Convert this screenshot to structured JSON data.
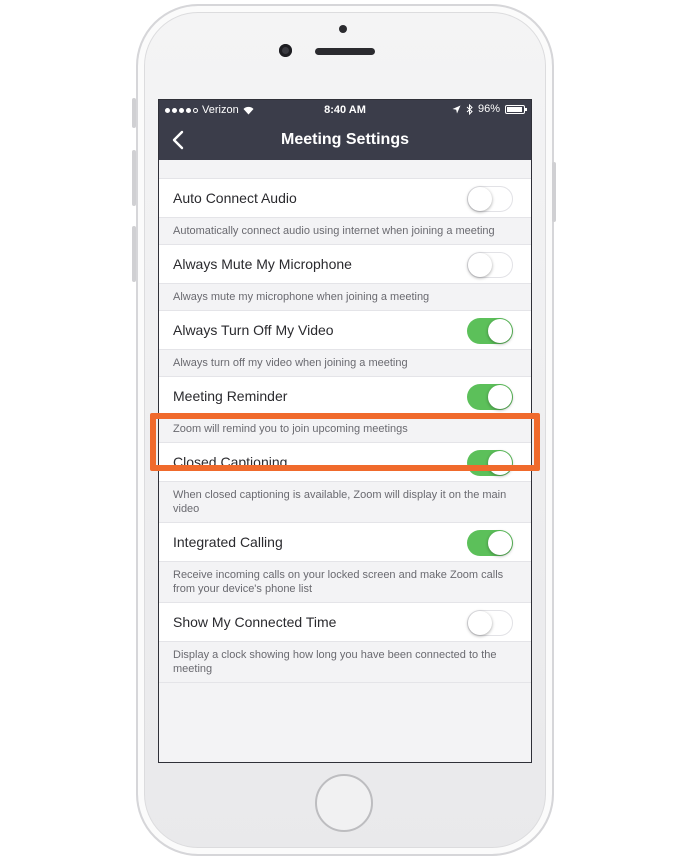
{
  "statusbar": {
    "carrier": "Verizon",
    "time": "8:40 AM",
    "battery": "96%"
  },
  "navbar": {
    "title": "Meeting Settings"
  },
  "settings": [
    {
      "label": "Auto Connect Audio",
      "enabled": false,
      "description": "Automatically connect audio using internet when joining a meeting"
    },
    {
      "label": "Always Mute My Microphone",
      "enabled": false,
      "description": "Always mute my microphone when joining a meeting"
    },
    {
      "label": "Always Turn Off My Video",
      "enabled": true,
      "description": "Always turn off my video when joining a meeting"
    },
    {
      "label": "Meeting Reminder",
      "enabled": true,
      "description": "Zoom will remind you to join upcoming meetings"
    },
    {
      "label": "Closed Captioning",
      "enabled": true,
      "description": "When closed captioning is available, Zoom will display it on the main video"
    },
    {
      "label": "Integrated Calling",
      "enabled": true,
      "description": "Receive incoming calls on your locked screen and make Zoom calls from your device's phone list"
    },
    {
      "label": "Show My Connected Time",
      "enabled": false,
      "description": "Display a clock showing how long you have been connected to the meeting"
    }
  ],
  "colors": {
    "accent_on": "#5cc05a",
    "highlight": "#f06a2c",
    "navbar": "#3b3d4a"
  }
}
